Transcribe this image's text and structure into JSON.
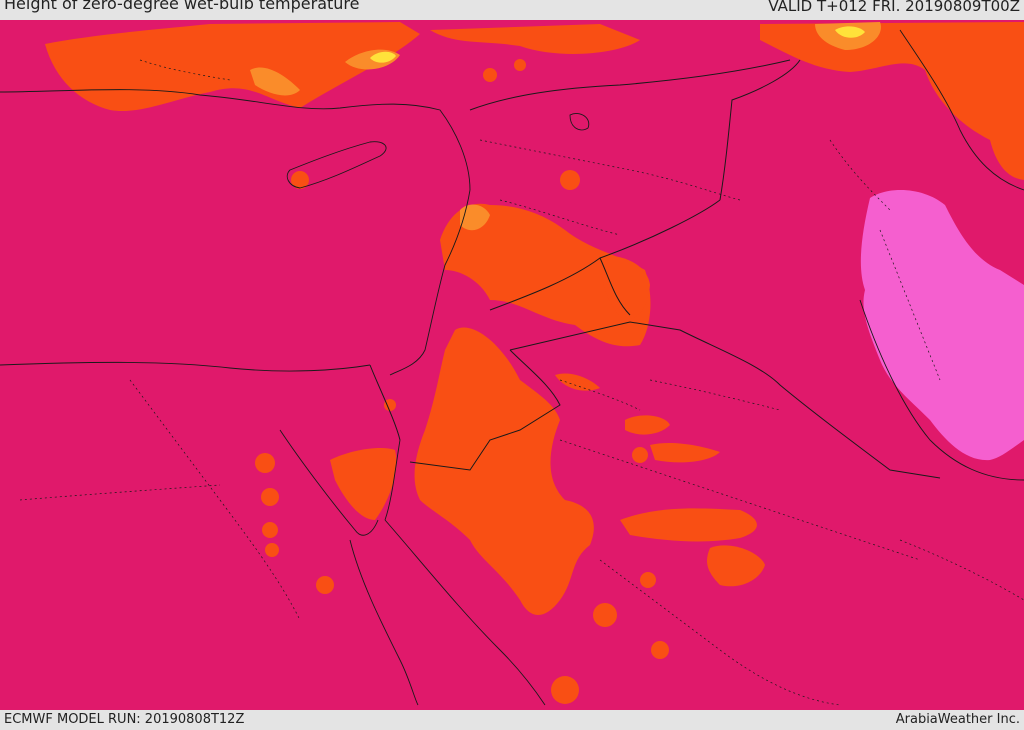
{
  "header": {
    "title": "Height of zero-degree wet-bulb temperature",
    "valid": "VALID T+012 FRI. 20190809T00Z"
  },
  "footer": {
    "model_run": "ECMWF MODEL RUN: 20190808T12Z",
    "credit": "ArabiaWeather Inc."
  },
  "legend_colors": {
    "base": "#e0196b",
    "orange": "#f94f14",
    "light_orange": "#fa8c2a",
    "yellow": "#ffe23a",
    "pink": "#f55fcf"
  }
}
